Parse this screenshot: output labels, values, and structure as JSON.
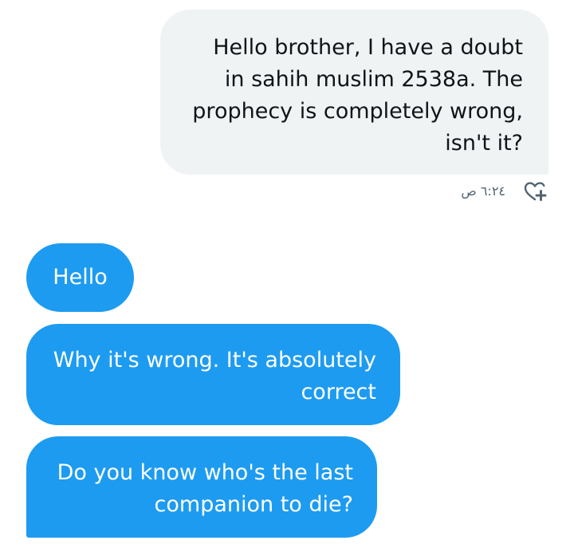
{
  "colors": {
    "sent_bubble": "#eff3f4",
    "sent_text": "#0f1419",
    "received_bubble": "#1d9bf0",
    "received_text": "#ffffff",
    "meta_text": "#536471"
  },
  "conversation": {
    "messages": [
      {
        "direction": "sent",
        "text": "Hello brother, I have a doubt\nin sahih muslim 2538a. The\nprophecy is completely wrong,\nisn't it?",
        "time": "٦:٢٤ ص",
        "reaction_icon": "heart-plus-icon"
      },
      {
        "direction": "received",
        "text": "Hello"
      },
      {
        "direction": "received",
        "text": "Why it's wrong. It's absolutely\ncorrect"
      },
      {
        "direction": "received",
        "text": "Do you know who's the last\ncompanion to die?"
      }
    ]
  }
}
